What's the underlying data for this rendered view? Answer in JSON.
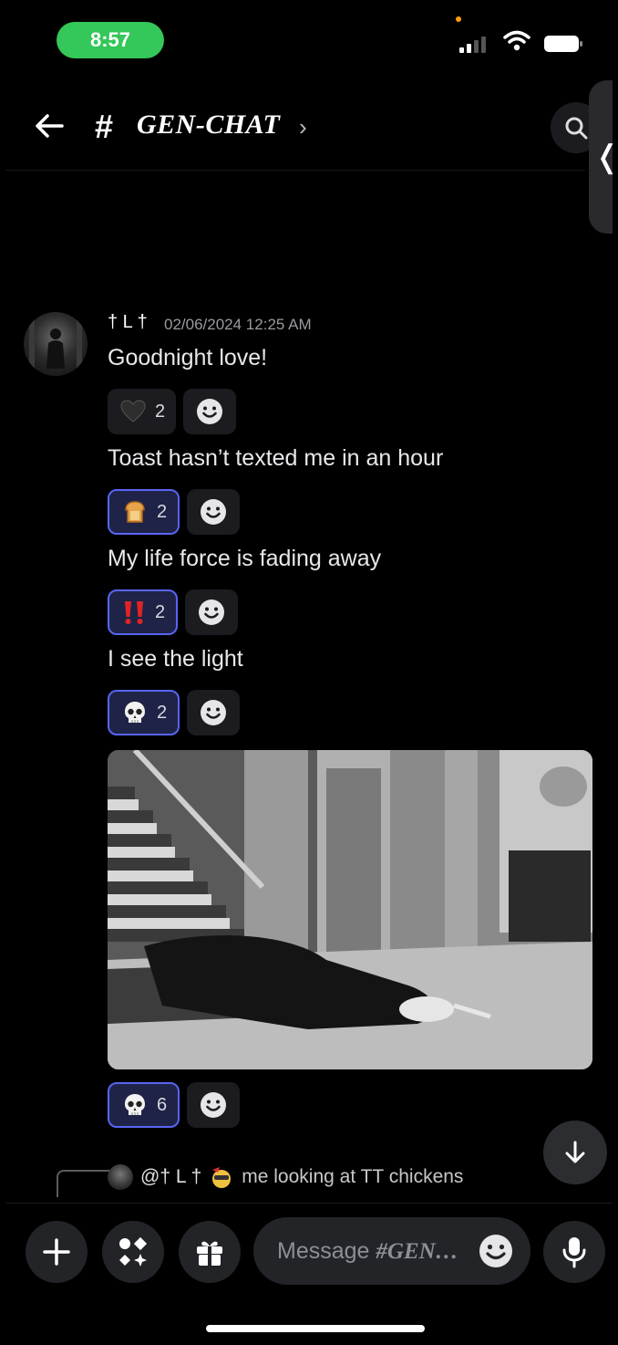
{
  "status": {
    "time": "8:57"
  },
  "header": {
    "hash": "#",
    "channel_name": "GEN-CHAT",
    "chevron": "›",
    "side_tab_chevron": "❬"
  },
  "message": {
    "username": "† L †",
    "timestamp": "02/06/2024 12:25 AM",
    "lines": [
      {
        "text": "Goodnight love!",
        "reaction": {
          "emoji": "black-heart",
          "count": "2",
          "active": false
        }
      },
      {
        "text": "Toast hasn’t texted me in an hour",
        "reaction": {
          "emoji": "bread",
          "count": "2",
          "active": true
        }
      },
      {
        "text": "My life force is fading away",
        "reaction": {
          "emoji": "double-exclamation",
          "count": "2",
          "active": true
        }
      },
      {
        "text": "I see the light",
        "reaction": {
          "emoji": "skull",
          "count": "2",
          "active": true
        }
      }
    ],
    "image_reaction": {
      "emoji": "skull",
      "count": "6",
      "active": true
    }
  },
  "reply_preview": {
    "user": "@† L †",
    "text": "me looking at TT chickens"
  },
  "composer": {
    "placeholder_prefix": "Message ",
    "placeholder_channel": "#GEN…"
  },
  "colors": {
    "accent": "#5865f2",
    "status_green": "#34c759",
    "background": "#000000"
  }
}
